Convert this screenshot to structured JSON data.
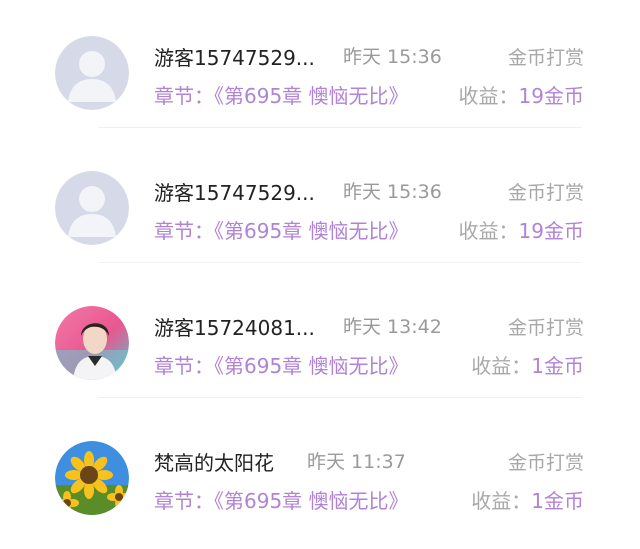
{
  "records": [
    {
      "avatar": "default-person-avatar",
      "name": "游客15747529...",
      "time": "昨天 15:36",
      "type": "金币打赏",
      "chapter": "章节：《第695章 懊恼无比》",
      "income_label": "收益：",
      "income_value": "19金币"
    },
    {
      "avatar": "default-person-avatar",
      "name": "游客15747529...",
      "time": "昨天 15:36",
      "type": "金币打赏",
      "chapter": "章节：《第695章 懊恼无比》",
      "income_label": "收益：",
      "income_value": "19金币"
    },
    {
      "avatar": "user-photo-avatar",
      "name": "游客15724081...",
      "time": "昨天 13:42",
      "type": "金币打赏",
      "chapter": "章节：《第695章 懊恼无比》",
      "income_label": "收益：",
      "income_value": "1金币"
    },
    {
      "avatar": "sunflower-avatar",
      "name": "梵高的太阳花",
      "time": "昨天 11:37",
      "type": "金币打赏",
      "chapter": "章节：《第695章 懊恼无比》",
      "income_label": "收益：",
      "income_value": "1金币"
    }
  ],
  "colors": {
    "accent_purple": "#b083d6",
    "name_text": "#222222",
    "muted_text": "#a8a8a8",
    "avatar_default_bg": "#d5d9e8"
  }
}
